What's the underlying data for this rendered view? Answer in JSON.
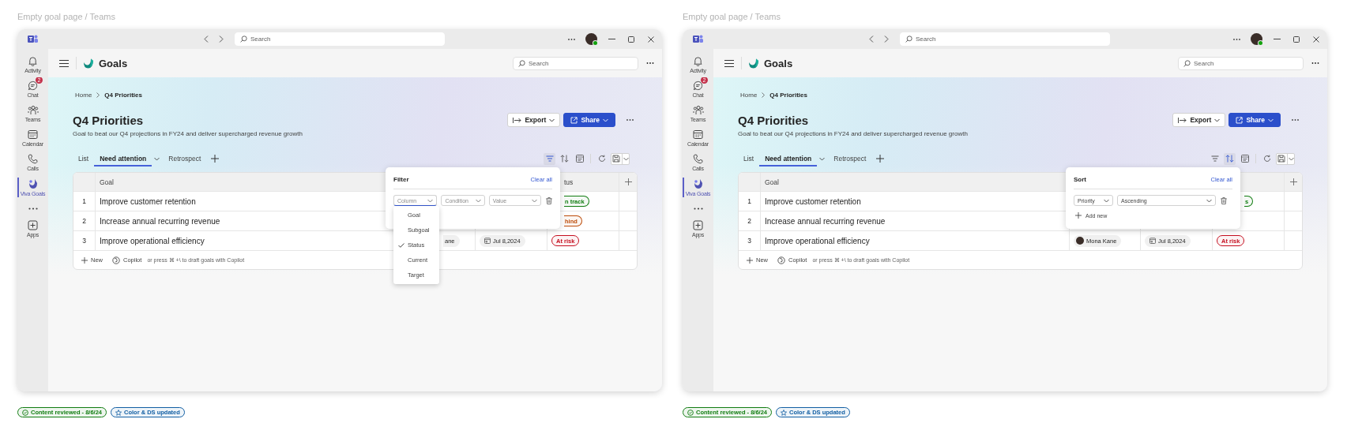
{
  "frames": [
    {
      "caption": "Empty goal page / Teams",
      "titlebar": {
        "search_placeholder": "Search"
      },
      "rail": [
        {
          "kind": "bell",
          "label": "Activity",
          "selected": false
        },
        {
          "kind": "chat",
          "label": "Chat",
          "badge": "2",
          "selected": false
        },
        {
          "kind": "teams",
          "label": "Teams",
          "selected": false
        },
        {
          "kind": "calendar",
          "label": "Calendar",
          "selected": false
        },
        {
          "kind": "calls",
          "label": "Calls",
          "selected": false
        },
        {
          "kind": "goals",
          "label": "Viva Goals",
          "selected": true
        },
        {
          "kind": "more",
          "selected": false
        },
        {
          "kind": "apps",
          "label": "Apps",
          "selected": false
        }
      ],
      "app": {
        "name": "Goals",
        "search_placeholder": "Search"
      },
      "breadcrumb": [
        "Home",
        "Q4 Priorities"
      ],
      "page": {
        "title": "Q4 Priorities",
        "description": "Goal to beat our Q4 projections in FY24 and deliver supercharged revenue growth",
        "buttons": [
          {
            "label": "Export",
            "kind": "secondary"
          },
          {
            "label": "Share",
            "kind": "primary"
          }
        ]
      },
      "tabs": [
        {
          "label": "List",
          "selected": false
        },
        {
          "label": "Need attention",
          "selected": true
        },
        {
          "label": "Retrospect",
          "selected": false
        }
      ],
      "tools": [
        {
          "kind": "filter",
          "selected": true
        },
        {
          "kind": "sort",
          "selected": false
        },
        {
          "kind": "card",
          "selected": false
        },
        {
          "kind": "refresh",
          "selected": false
        },
        {
          "kind": "save",
          "selected": false
        }
      ],
      "table": {
        "header": {
          "goal": "Goal",
          "status": "tus"
        },
        "rows": [
          {
            "number": "1",
            "goal": "Improve customer retention",
            "status": {
              "label": "n track",
              "color": "#107c10",
              "clipped": true
            }
          },
          {
            "number": "2",
            "goal": "Increase annual recurring revenue",
            "status": {
              "label": "hind",
              "color": "#bc4b09",
              "clipped": true
            }
          },
          {
            "number": "3",
            "goal": "Improve operational efficiency",
            "owner": {
              "name": "ane",
              "avatar": false,
              "clipped": true
            },
            "date": "Jul 8,2024",
            "status": {
              "label": "At risk",
              "color": "#c50f1f",
              "clipped": false
            }
          }
        ],
        "footer": {
          "new": "New",
          "copilot": "Copilot",
          "hint": "or press ⌘ +\\ to draft goals with Copilot"
        }
      },
      "popover": {
        "kind": "filter",
        "title": "Filter",
        "clear": "Clear all",
        "fields": [
          {
            "placeholder": "Column",
            "focused": true
          },
          {
            "placeholder": "Condition",
            "focused": false
          },
          {
            "placeholder": "Value",
            "focused": false
          }
        ],
        "menu": [
          {
            "label": "Goal",
            "selected": false
          },
          {
            "label": "Subgoal",
            "selected": false
          },
          {
            "label": "Status",
            "selected": true
          },
          {
            "label": "Current",
            "selected": false
          },
          {
            "label": "Target",
            "selected": false
          }
        ]
      },
      "badges": [
        {
          "kind": "check",
          "label": "Content reviewed - 8/6/24",
          "color": "#107c10"
        },
        {
          "kind": "star",
          "label": "Color & DS updated",
          "color": "#115ea3"
        }
      ]
    },
    {
      "caption": "Empty goal page / Teams",
      "titlebar": {
        "search_placeholder": "Search"
      },
      "rail": [
        {
          "kind": "bell",
          "label": "Activity",
          "selected": false
        },
        {
          "kind": "chat",
          "label": "Chat",
          "badge": "2",
          "selected": false
        },
        {
          "kind": "teams",
          "label": "Teams",
          "selected": false
        },
        {
          "kind": "calendar",
          "label": "Calendar",
          "selected": false
        },
        {
          "kind": "calls",
          "label": "Calls",
          "selected": false
        },
        {
          "kind": "goals",
          "label": "Viva Goals",
          "selected": true
        },
        {
          "kind": "more",
          "selected": false
        },
        {
          "kind": "apps",
          "label": "Apps",
          "selected": false
        }
      ],
      "app": {
        "name": "Goals",
        "search_placeholder": "Search"
      },
      "breadcrumb": [
        "Home",
        "Q4 Priorities"
      ],
      "page": {
        "title": "Q4 Priorities",
        "description": "Goal to beat our Q4 projections in FY24 and deliver supercharged revenue growth",
        "buttons": [
          {
            "label": "Export",
            "kind": "secondary"
          },
          {
            "label": "Share",
            "kind": "primary"
          }
        ]
      },
      "tabs": [
        {
          "label": "List",
          "selected": false
        },
        {
          "label": "Need attention",
          "selected": true
        },
        {
          "label": "Retrospect",
          "selected": false
        }
      ],
      "tools": [
        {
          "kind": "filter",
          "selected": false
        },
        {
          "kind": "sort",
          "selected": true
        },
        {
          "kind": "card",
          "selected": false
        },
        {
          "kind": "refresh",
          "selected": false
        },
        {
          "kind": "save",
          "selected": false
        }
      ],
      "table": {
        "header": {
          "goal": "Goal"
        },
        "rows": [
          {
            "number": "1",
            "goal": "Improve customer retention",
            "status": {
              "label": "s",
              "color": "#107c10",
              "clipped": true
            }
          },
          {
            "number": "2",
            "goal": "Increase annual recurring revenue"
          },
          {
            "number": "3",
            "goal": "Improve operational efficiency",
            "owner": {
              "name": "Mona Kane",
              "avatar": true,
              "clipped": false
            },
            "date": "Jul 8,2024",
            "status": {
              "label": "At risk",
              "color": "#c50f1f",
              "clipped": false
            }
          }
        ],
        "footer": {
          "new": "New",
          "copilot": "Copilot",
          "hint": "or press ⌘ +\\ to draft goals with Copilot"
        }
      },
      "popover": {
        "kind": "sort",
        "title": "Sort",
        "clear": "Clear all",
        "fields": [
          {
            "value": "Priority"
          },
          {
            "value": "Ascending"
          }
        ],
        "add": "Add new"
      },
      "badges": [
        {
          "kind": "check",
          "label": "Content reviewed - 8/6/24",
          "color": "#107c10"
        },
        {
          "kind": "star",
          "label": "Color & DS updated",
          "color": "#115ea3"
        }
      ]
    }
  ]
}
